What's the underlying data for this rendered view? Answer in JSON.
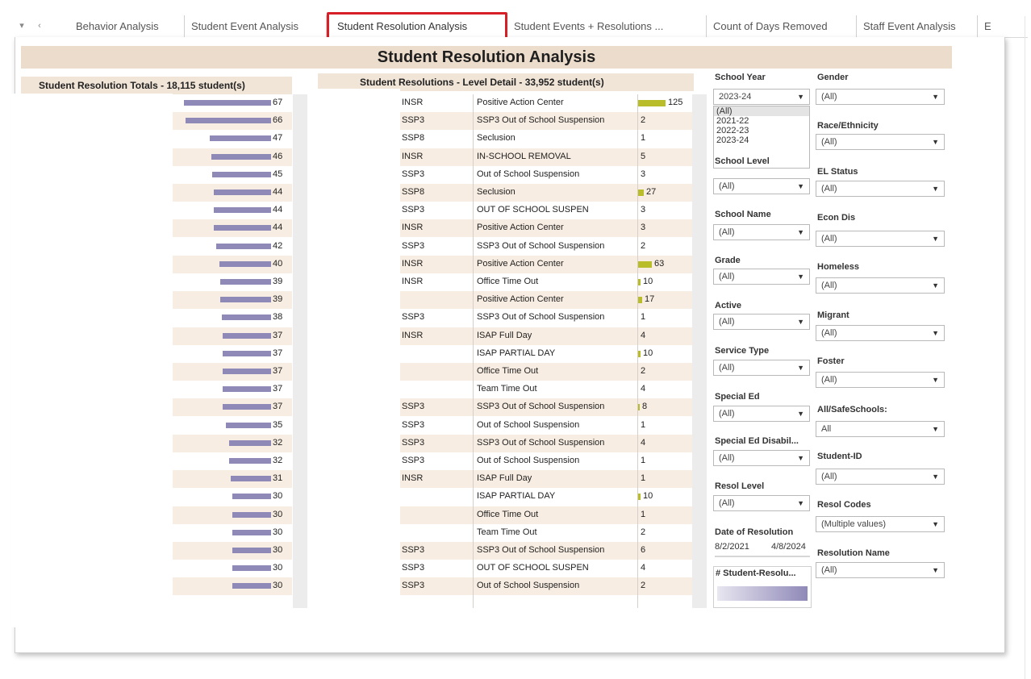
{
  "tabs": [
    {
      "label": "Behavior Analysis"
    },
    {
      "label": "Student Event Analysis"
    },
    {
      "label": "Student Resolution Analysis"
    },
    {
      "label": "Student Events + Resolutions ..."
    },
    {
      "label": "Count of Days Removed"
    },
    {
      "label": "Staff Event Analysis"
    },
    {
      "label": "E"
    }
  ],
  "dashboard_title": "Student Resolution Analysis",
  "left_panel": {
    "header": "Student Resolution Totals  - 18,115 student(s)",
    "bar_color": "#8f89b8",
    "values": [
      67,
      66,
      47,
      46,
      45,
      44,
      44,
      44,
      42,
      40,
      39,
      39,
      38,
      37,
      37,
      37,
      37,
      37,
      35,
      32,
      32,
      31,
      30,
      30,
      30,
      30,
      30,
      30
    ]
  },
  "mid_panel": {
    "header": "Student Resolutions - Level Detail  - 33,952 student(s)",
    "bar_color": "#b9bd2a",
    "rows": [
      {
        "level": "INSR",
        "name": "Positive Action Center",
        "count": "125",
        "bar": 125
      },
      {
        "level": "SSP3",
        "name": "SSP3 Out of School Suspension",
        "count": "2",
        "bar": 0
      },
      {
        "level": "SSP8",
        "name": "Seclusion",
        "count": "1",
        "bar": 0
      },
      {
        "level": "INSR",
        "name": "IN-SCHOOL REMOVAL",
        "count": "5",
        "bar": 0
      },
      {
        "level": "SSP3",
        "name": "Out of School Suspension",
        "count": "3",
        "bar": 0
      },
      {
        "level": "SSP8",
        "name": "Seclusion",
        "count": "27",
        "bar": 27
      },
      {
        "level": "SSP3",
        "name": "OUT OF SCHOOL SUSPEN",
        "count": "3",
        "bar": 0
      },
      {
        "level": "INSR",
        "name": "Positive Action Center",
        "count": "3",
        "bar": 0
      },
      {
        "level": "SSP3",
        "name": "SSP3 Out of School Suspension",
        "count": "2",
        "bar": 0
      },
      {
        "level": "INSR",
        "name": "Positive Action Center",
        "count": "63",
        "bar": 63
      },
      {
        "level": "INSR",
        "name": "Office Time Out",
        "count": "10",
        "bar": 10
      },
      {
        "level": "",
        "name": "Positive Action Center",
        "count": "17",
        "bar": 17
      },
      {
        "level": "SSP3",
        "name": "SSP3 Out of School Suspension",
        "count": "1",
        "bar": 0
      },
      {
        "level": "INSR",
        "name": "ISAP Full Day",
        "count": "4",
        "bar": 0
      },
      {
        "level": "",
        "name": "ISAP PARTIAL DAY",
        "count": "10",
        "bar": 10
      },
      {
        "level": "",
        "name": "Office Time Out",
        "count": "2",
        "bar": 0
      },
      {
        "level": "",
        "name": "Team Time Out",
        "count": "4",
        "bar": 0
      },
      {
        "level": "SSP3",
        "name": "SSP3 Out of School Suspension",
        "count": "8",
        "bar": 8
      },
      {
        "level": "SSP3",
        "name": "Out of School Suspension",
        "count": "1",
        "bar": 0
      },
      {
        "level": "SSP3",
        "name": "SSP3 Out of School Suspension",
        "count": "4",
        "bar": 0
      },
      {
        "level": "SSP3",
        "name": "Out of School Suspension",
        "count": "1",
        "bar": 0
      },
      {
        "level": "INSR",
        "name": "ISAP Full Day",
        "count": "1",
        "bar": 0
      },
      {
        "level": "",
        "name": "ISAP PARTIAL DAY",
        "count": "10",
        "bar": 10
      },
      {
        "level": "",
        "name": "Office Time Out",
        "count": "1",
        "bar": 0
      },
      {
        "level": "",
        "name": "Team Time Out",
        "count": "2",
        "bar": 0
      },
      {
        "level": "SSP3",
        "name": "SSP3 Out of School Suspension",
        "count": "6",
        "bar": 0
      },
      {
        "level": "SSP3",
        "name": "OUT OF SCHOOL SUSPEN",
        "count": "4",
        "bar": 0
      },
      {
        "level": "SSP3",
        "name": "Out of School Suspension",
        "count": "2",
        "bar": 0
      }
    ]
  },
  "filters": {
    "school_year": {
      "label": "School Year",
      "value": "2023-24",
      "options": [
        "(All)",
        "2021-22",
        "2022-23",
        "2023-24"
      ]
    },
    "gender": {
      "label": "Gender",
      "value": "(All)"
    },
    "race": {
      "label": "Race/Ethnicity",
      "value": "(All)"
    },
    "school_level": {
      "label": "School Level",
      "value": "(All)"
    },
    "el_status": {
      "label": "EL Status",
      "value": "(All)"
    },
    "school_name": {
      "label": "School Name",
      "value": "(All)"
    },
    "econ_dis": {
      "label": "Econ Dis",
      "value": "(All)"
    },
    "grade": {
      "label": "Grade",
      "value": "(All)"
    },
    "homeless": {
      "label": "Homeless",
      "value": "(All)"
    },
    "active": {
      "label": "Active",
      "value": "(All)"
    },
    "migrant": {
      "label": "Migrant",
      "value": "(All)"
    },
    "service_type": {
      "label": "Service Type",
      "value": "(All)"
    },
    "foster": {
      "label": "Foster",
      "value": "(All)"
    },
    "special_ed": {
      "label": "Special Ed",
      "value": "(All)"
    },
    "all_safe_schools": {
      "label": "All/SafeSchools:",
      "value": "All"
    },
    "special_ed_disability": {
      "label": "Special Ed Disabil...",
      "value": "(All)"
    },
    "student_id": {
      "label": "Student-ID",
      "value": "(All)"
    },
    "resol_level": {
      "label": "Resol Level",
      "value": "(All)"
    },
    "resol_codes": {
      "label": "Resol Codes",
      "value": "(Multiple values)"
    },
    "date_of_resolution": {
      "label": "Date of Resolution",
      "start": "8/2/2021",
      "end": "4/8/2024"
    },
    "resolution_name": {
      "label": "Resolution Name",
      "value": "(All)"
    },
    "legend": {
      "label": "# Student-Resolu...",
      "from_color": "#ffffff",
      "to_color": "#8f89b8"
    }
  }
}
